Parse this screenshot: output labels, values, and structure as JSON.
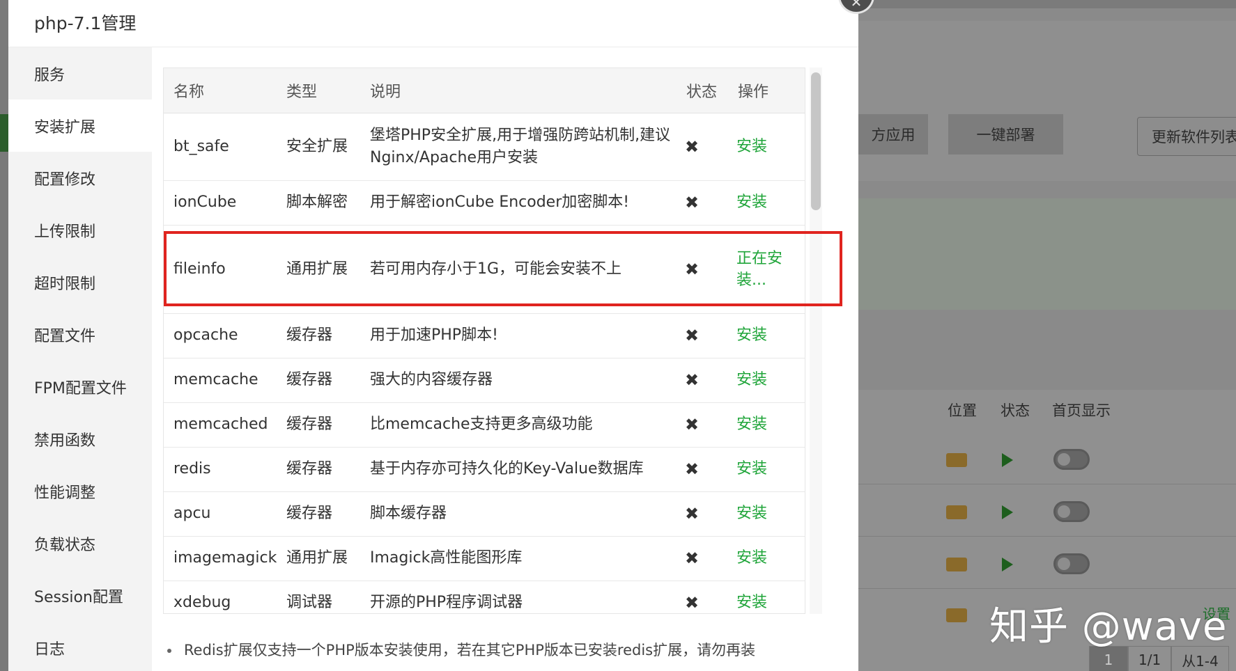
{
  "modal": {
    "title": "php-7.1管理",
    "close_icon": "close-icon"
  },
  "sidebar": {
    "active_index": 1,
    "items": [
      {
        "label": "服务"
      },
      {
        "label": "安装扩展"
      },
      {
        "label": "配置修改"
      },
      {
        "label": "上传限制"
      },
      {
        "label": "超时限制"
      },
      {
        "label": "配置文件"
      },
      {
        "label": "FPM配置文件"
      },
      {
        "label": "禁用函数"
      },
      {
        "label": "性能调整"
      },
      {
        "label": "负载状态"
      },
      {
        "label": "Session配置"
      },
      {
        "label": "日志"
      }
    ]
  },
  "table": {
    "columns": [
      "名称",
      "类型",
      "说明",
      "状态",
      "操作"
    ],
    "status_icon": "x-mark-icon",
    "rows": [
      {
        "name": "bt_safe",
        "type": "安全扩展",
        "desc": "堡塔PHP安全扩展,用于增强防跨站机制,建议Nginx/Apache用户安装",
        "status": "✖",
        "action": "安装"
      },
      {
        "name": "ionCube",
        "type": "脚本解密",
        "desc": "用于解密ionCube Encoder加密脚本!",
        "status": "✖",
        "action": "安装"
      },
      {
        "name": "fileinfo",
        "type": "通用扩展",
        "desc": "若可用内存小于1G，可能会安装不上",
        "status": "✖",
        "action": "正在安装..."
      },
      {
        "name": "opcache",
        "type": "缓存器",
        "desc": "用于加速PHP脚本!",
        "status": "✖",
        "action": "安装"
      },
      {
        "name": "memcache",
        "type": "缓存器",
        "desc": "强大的内容缓存器",
        "status": "✖",
        "action": "安装"
      },
      {
        "name": "memcached",
        "type": "缓存器",
        "desc": "比memcache支持更多高级功能",
        "status": "✖",
        "action": "安装"
      },
      {
        "name": "redis",
        "type": "缓存器",
        "desc": "基于内存亦可持久化的Key-Value数据库",
        "status": "✖",
        "action": "安装"
      },
      {
        "name": "apcu",
        "type": "缓存器",
        "desc": "脚本缓存器",
        "status": "✖",
        "action": "安装"
      },
      {
        "name": "imagemagick",
        "type": "通用扩展",
        "desc": "Imagick高性能图形库",
        "status": "✖",
        "action": "安装"
      },
      {
        "name": "xdebug",
        "type": "调试器",
        "desc": "开源的PHP程序调试器",
        "status": "✖",
        "action": "安装"
      }
    ]
  },
  "note": "Redis扩展仅支持一个PHP版本安装使用，若在其它PHP版本已安装redis扩展，请勿再装",
  "background": {
    "buttons": [
      "方应用",
      "一键部署",
      "更新软件列表"
    ],
    "list_headers": [
      "位置",
      "状态",
      "首页显示"
    ],
    "setting_link": "设置",
    "pager": {
      "current": "1",
      "pages": "1/1",
      "range": "从1-4"
    }
  },
  "watermark": "知乎 @wave",
  "colors": {
    "action_green": "#20a53a",
    "highlight_red": "#e0241f"
  }
}
